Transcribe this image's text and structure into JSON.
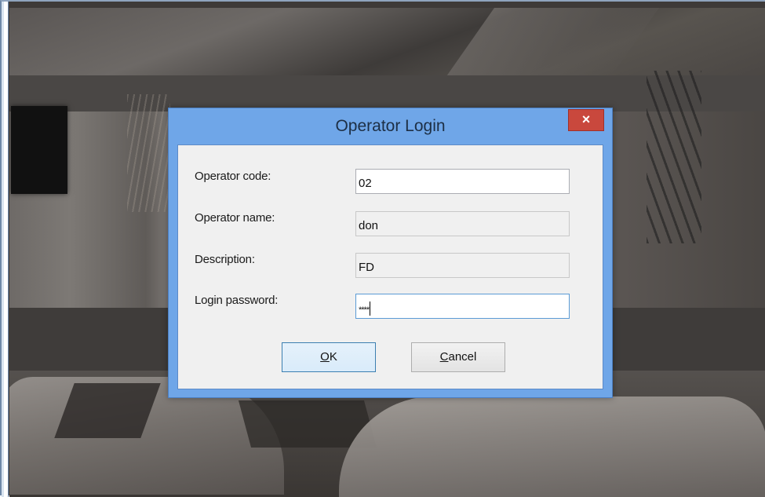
{
  "dialog": {
    "title": "Operator Login",
    "close_glyph": "×",
    "fields": {
      "code": {
        "label": "Operator code:",
        "value": "02"
      },
      "name": {
        "label": "Operator name:",
        "value": "don"
      },
      "description": {
        "label": "Description:",
        "value": "FD"
      },
      "password": {
        "label": "Login password:",
        "value": "****"
      }
    },
    "buttons": {
      "ok": {
        "accel": "O",
        "rest": "K"
      },
      "cancel": {
        "accel": "C",
        "rest": "ancel"
      }
    }
  },
  "colors": {
    "title_bar": "#6fa6e8",
    "close_button": "#c9483d",
    "client_bg": "#f0f0f0"
  },
  "icons": {
    "close": "close-icon"
  }
}
